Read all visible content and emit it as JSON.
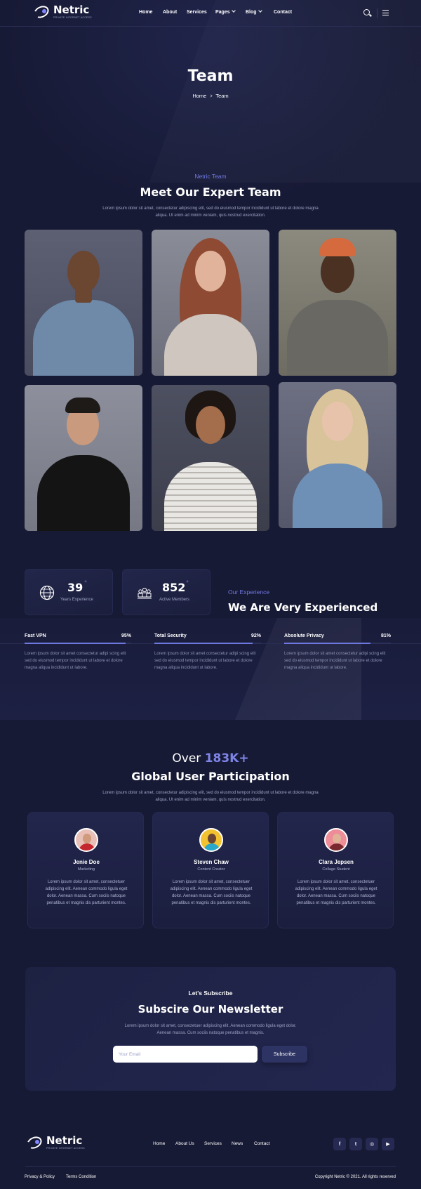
{
  "brand": {
    "name": "Netric",
    "tagline": "PRIVATE INTERNET ACCESS"
  },
  "nav": {
    "items": [
      {
        "label": "Home"
      },
      {
        "label": "About"
      },
      {
        "label": "Services"
      },
      {
        "label": "Pages"
      },
      {
        "label": "Blog"
      },
      {
        "label": "Contact"
      }
    ]
  },
  "hero": {
    "title": "Team",
    "breadcrumb": [
      "Home",
      "Team"
    ]
  },
  "team_section": {
    "eyebrow": "Netric Team",
    "title": "Meet Our Expert Team",
    "description": "Lorem ipsum dolor sit amet, consectetur adipiscing elit, sed do eiusmod tempor incididunt ut labore et dolore magna aliqua. Ut enim ad minim veniam, quis nostrud exercitation."
  },
  "experience": {
    "stats": [
      {
        "value": "39",
        "suffix": "+",
        "label": "Years Experience",
        "icon": "globe-icon"
      },
      {
        "value": "852",
        "suffix": "+",
        "label": "Active Members",
        "icon": "members-icon"
      }
    ],
    "eyebrow": "Our Experience",
    "title": "We Are Very Experienced",
    "skills": [
      {
        "name": "Fast VPN",
        "percent_label": "95%",
        "percent": 95,
        "description": "Lorem ipsum dolor sit amet consectetur adipi scing elit sed do eiusmod tempor incididunt ut labore et dolore magna aliqua incididunt ut labore."
      },
      {
        "name": "Total Security",
        "percent_label": "92%",
        "percent": 92,
        "description": "Lorem ipsum dolor sit amet consectetur adipi scing elit sed do eiusmod tempor incididunt ut labore et dolore magna aliqua incididunt ut labore."
      },
      {
        "name": "Absolute Privacy",
        "percent_label": "81%",
        "percent": 81,
        "description": "Lorem ipsum dolor sit amet consectetur adipi scing elit sed do eiusmod tempor incididunt ut labore et dolore magna aliqua incididunt ut labore."
      }
    ]
  },
  "participation": {
    "over": "Over",
    "count": "183K+",
    "title": "Global User Participation",
    "description": "Lorem ipsum dolor sit amet, consectetur adipiscing elit, sed do eiusmod tempor incididunt ut labore et dolore magna aliqua. Ut enim ad minim veniam, quis nostrud exercitation.",
    "users": [
      {
        "name": "Jenie Doe",
        "role": "Marketing",
        "quote": "Lorem ipsum dolor sit amet, consectetuer adipiscing elit. Aenean commodo ligula eget dolor. Aenean massa. Cum sociis natoque penatibus et magnis dis parturient montes."
      },
      {
        "name": "Steven Chaw",
        "role": "Content Creator",
        "quote": "Lorem ipsum dolor sit amet, consectetuer adipiscing elit. Aenean commodo ligula eget dolor. Aenean massa. Cum sociis natoque penatibus et magnis dis parturient montes."
      },
      {
        "name": "Clara Jepsen",
        "role": "Collage Student",
        "quote": "Lorem ipsum dolor sit amet, consectetuer adipiscing elit. Aenean commodo ligula eget dolor. Aenean massa. Cum sociis natoque penatibus et magnis dis parturient montes."
      }
    ]
  },
  "newsletter": {
    "eyebrow": "Let's Subscribe",
    "title": "Subscire Our Newsletter",
    "description": "Lorem ipsum dolor sit amet, consectetuer adipiscing elit. Aenean commodo ligula eget dolor. Aenean massa. Cum sociis natoque penatibus et magnis.",
    "input_placeholder": "Your Email",
    "button_label": "Subscribe"
  },
  "footer": {
    "links": [
      {
        "label": "Home"
      },
      {
        "label": "About Us"
      },
      {
        "label": "Services"
      },
      {
        "label": "News"
      },
      {
        "label": "Contact"
      }
    ],
    "social": [
      {
        "glyph": "f",
        "icon": "facebook-icon"
      },
      {
        "glyph": "t",
        "icon": "twitter-icon"
      },
      {
        "glyph": "◎",
        "icon": "instagram-icon"
      },
      {
        "glyph": "▶",
        "icon": "youtube-icon"
      }
    ],
    "privacy": "Privacy & Policy",
    "terms": "Terms Condition",
    "copyright": "Copyright Netric © 2021. All rights reserved"
  },
  "colors": {
    "background": "#171a35",
    "accent": "#6f78e0",
    "card": "#22264a"
  }
}
